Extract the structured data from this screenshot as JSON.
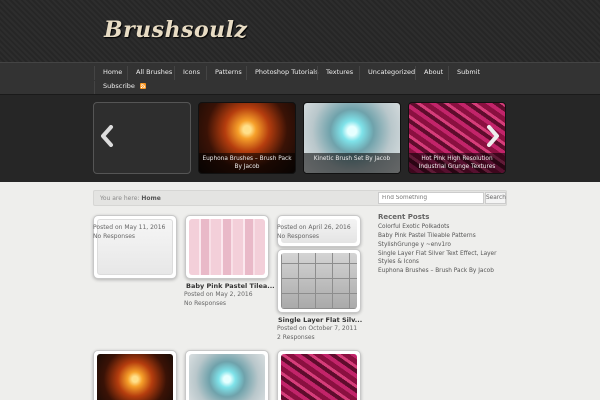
{
  "header": {
    "logo": "Brushsoulz"
  },
  "nav": {
    "items": [
      "Home",
      "All Brushes",
      "Icons",
      "Patterns",
      "Photoshop Tutorials",
      "Textures",
      "Uncategorized",
      "About",
      "Submit"
    ],
    "subscribe": "Subscribe"
  },
  "slider": {
    "captions": [
      "Euphona Brushes – Brush Pack By Jacob",
      "Kinetic Brush Set By Jacob",
      "Hot Pink High Resolution Industrial Grunge Textures"
    ]
  },
  "breadcrumb": {
    "prefix": "You are here:",
    "current": "Home"
  },
  "search": {
    "placeholder": "Find Something",
    "button": "Search"
  },
  "posts": [
    {
      "title": "",
      "date": "Posted on May 11, 2016",
      "responses": "No Responses"
    },
    {
      "title": "Baby Pink Pastel Tilea...",
      "date": "Posted on May 2, 2016",
      "responses": "No Responses"
    },
    {
      "title": "",
      "date": "Posted on April 26, 2016",
      "responses": "No Responses"
    },
    {
      "title": "Single Layer Flat Silv...",
      "date": "Posted on October 7, 2011",
      "responses": "2 Responses"
    }
  ],
  "recent": {
    "heading": "Recent Posts",
    "items": [
      "Colorful Exotic Polkadots",
      "Baby Pink Pastel Tileable Patterns",
      "StylishGrunge y ~env1ro",
      "Single Layer Flat Silver Text Effect, Layer Styles & Icons",
      "Euphona Brushes – Brush Pack By Jacob"
    ]
  },
  "colors": {
    "header_bg": "#2a2a2a",
    "nav_bg": "#333333",
    "body_bg": "#eeeeec",
    "logo": "#e8dcc4",
    "rss": "#f7931e"
  },
  "icons": [
    "rss-icon",
    "chevron-left-icon",
    "chevron-right-icon"
  ]
}
